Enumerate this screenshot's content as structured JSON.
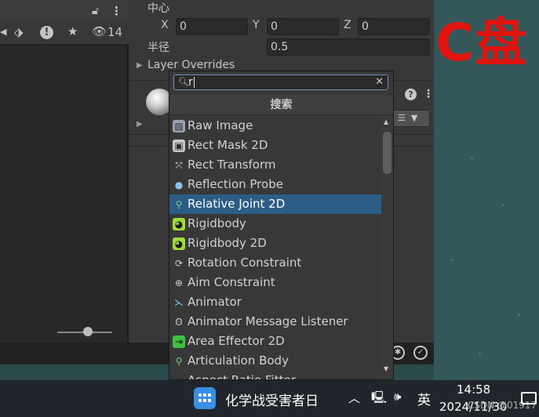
{
  "wallpaper": {
    "text": "C盘",
    "text_color": "#e0140f"
  },
  "left_panel": {
    "badge_count": "14",
    "toolbar_icons": [
      "lock-icon",
      "kebab-menu-icon",
      "play-icon",
      "tag-icon",
      "error-icon",
      "star-icon",
      "visibility-icon"
    ]
  },
  "inspector": {
    "center_label": "中心",
    "x_label": "X",
    "x_value": "0",
    "y_label": "Y",
    "y_value": "0",
    "z_label": "Z",
    "z_value": "0",
    "radius_label": "半径",
    "radius_value": "0.5",
    "layer_overrides_label": "Layer Overrides"
  },
  "popup": {
    "search_value": "r",
    "header": "搜索",
    "selected_index": 4,
    "items": [
      {
        "label": "Raw Image",
        "icon": "raw-image-icon"
      },
      {
        "label": "Rect Mask 2D",
        "icon": "rect-mask-icon"
      },
      {
        "label": "Rect Transform",
        "icon": "rect-transform-icon"
      },
      {
        "label": "Reflection Probe",
        "icon": "reflection-probe-icon"
      },
      {
        "label": "Relative Joint 2D",
        "icon": "joint-icon"
      },
      {
        "label": "Rigidbody",
        "icon": "rigidbody-icon"
      },
      {
        "label": "Rigidbody 2D",
        "icon": "rigidbody-2d-icon"
      },
      {
        "label": "Rotation Constraint",
        "icon": "rotation-constraint-icon"
      },
      {
        "label": "Aim Constraint",
        "icon": "aim-constraint-icon"
      },
      {
        "label": "Animator",
        "icon": "animator-icon"
      },
      {
        "label": "Animator Message Listener",
        "icon": "listener-icon"
      },
      {
        "label": "Area Effector 2D",
        "icon": "area-effector-icon"
      },
      {
        "label": "Articulation Body",
        "icon": "articulation-body-icon"
      },
      {
        "label": "Aspect Ratio Fitter",
        "icon": "aspect-ratio-icon"
      }
    ]
  },
  "taskbar": {
    "app_title": "化学战受害者日",
    "ime": "英",
    "time": "14:58",
    "date": "2024/11/30",
    "watermark": "CSDN @01917"
  }
}
